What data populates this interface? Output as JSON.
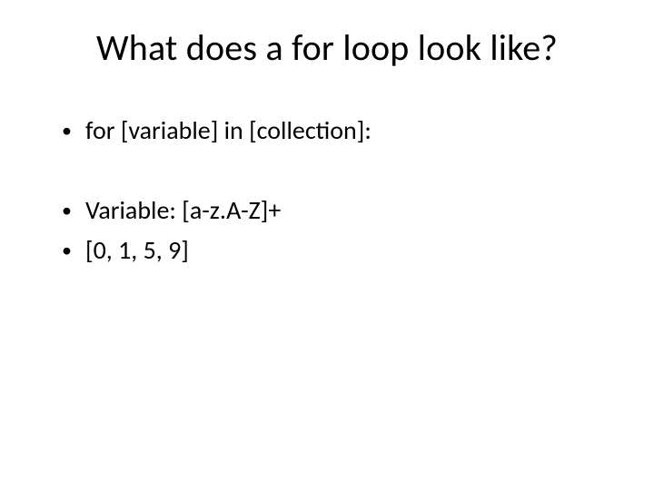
{
  "title": "What does a for loop look like?",
  "bullets": {
    "b0": "for [variable] in [collection]:",
    "b1": "Variable: [a-z.A-Z]+",
    "b2": "[0, 1, 5, 9]"
  },
  "glyph": "•"
}
